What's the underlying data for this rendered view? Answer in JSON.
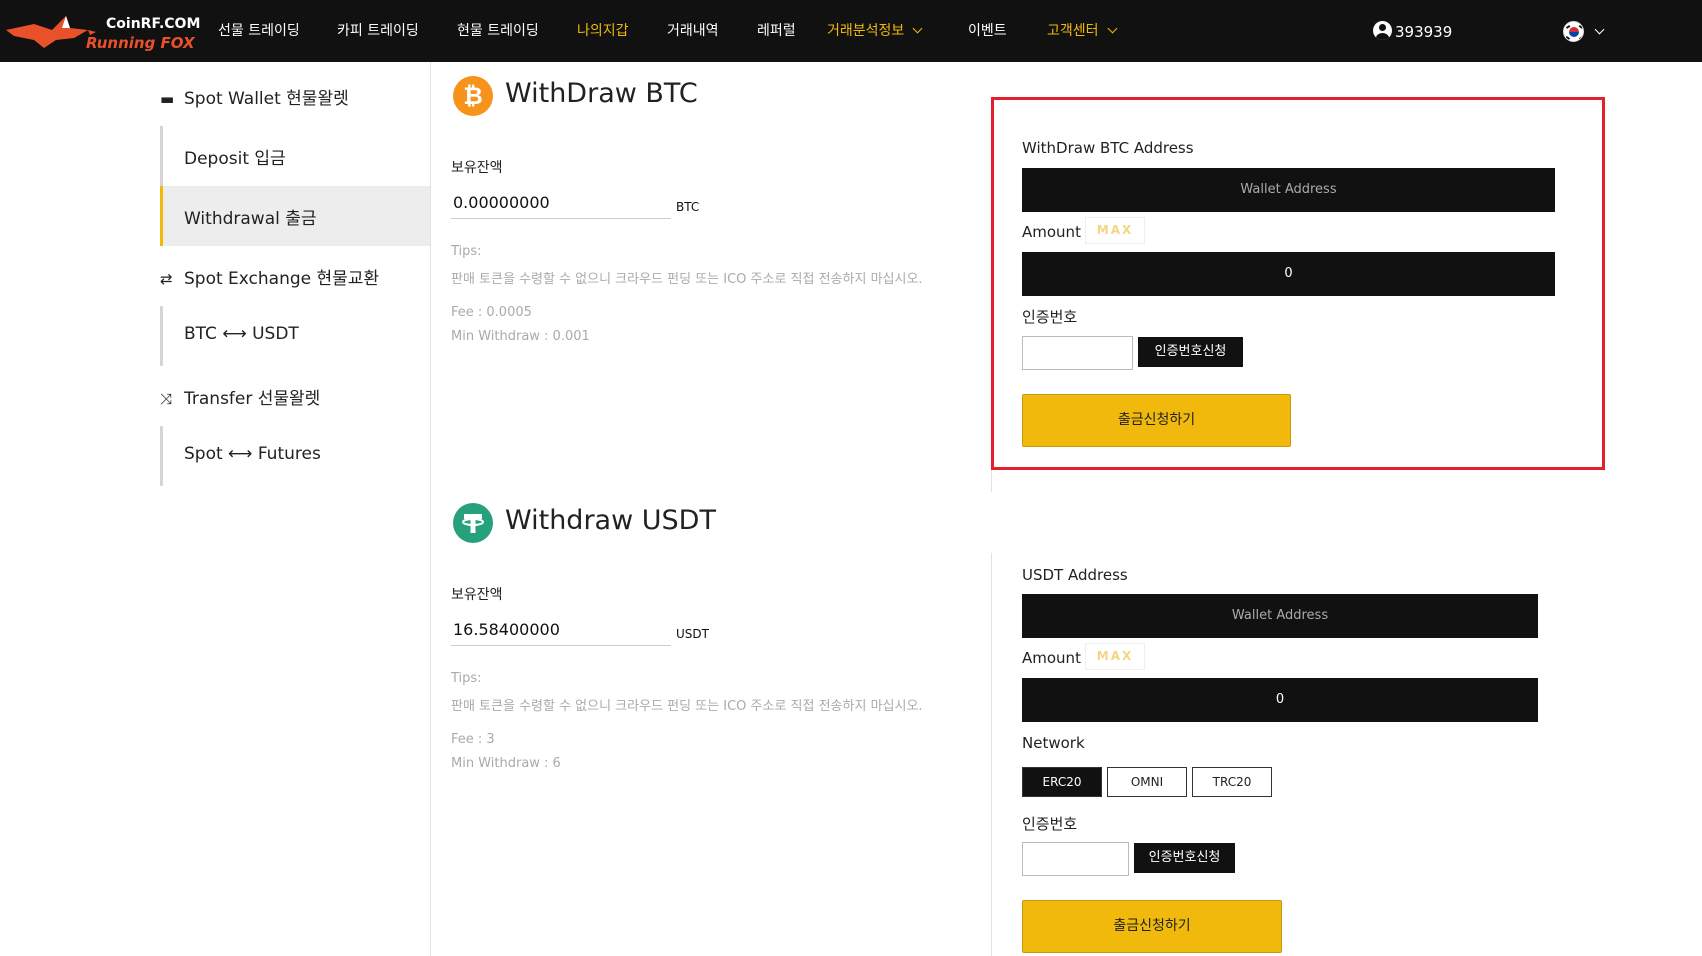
{
  "header": {
    "logo_top": "CoinRF.COM",
    "logo_bottom": "Running FOX",
    "nav": [
      {
        "label": "선물 트레이딩"
      },
      {
        "label": "카피 트레이딩"
      },
      {
        "label": "현물 트레이딩"
      },
      {
        "label": "나의지갑"
      },
      {
        "label": "거래내역"
      },
      {
        "label": "레퍼럴"
      },
      {
        "label": "거래분석정보"
      },
      {
        "label": "이벤트"
      },
      {
        "label": "고객센터"
      }
    ],
    "user_id": "393939",
    "active_color": "#f0b90b"
  },
  "sidebar": {
    "spot_wallet": "Spot Wallet 현물왈렛",
    "deposit": "Deposit 입금",
    "withdrawal": "Withdrawal 출금",
    "spot_exchange": "Spot Exchange 현물교환",
    "btc_usdt": "BTC ⟷ USDT",
    "transfer": "Transfer 선물왈렛",
    "spot_futures": "Spot ⟷ Futures"
  },
  "btc": {
    "title": "WithDraw BTC",
    "balance_label": "보유잔액",
    "balance": "0.00000000",
    "unit": "BTC",
    "tips_label": "Tips:",
    "tips_text": "판매 토큰을 수령할 수 없으니 크라우드 펀딩 또는 ICO 주소로 직접 전송하지 마십시오.",
    "fee": "Fee : 0.0005",
    "min_withdraw": "Min Withdraw : 0.001",
    "address_label": "WithDraw BTC Address",
    "address_placeholder": "Wallet Address",
    "amount_label": "Amount",
    "max_label": "MAX",
    "amount_value": "0",
    "code_label": "인증번호",
    "code_button": "인증번호신청",
    "submit": "출금신청하기"
  },
  "usdt": {
    "title": "Withdraw USDT",
    "balance_label": "보유잔액",
    "balance": "16.58400000",
    "unit": "USDT",
    "tips_label": "Tips:",
    "tips_text": "판매 토큰을 수령할 수 없으니 크라우드 펀딩 또는 ICO 주소로 직접 전송하지 마십시오.",
    "fee": "Fee : 3",
    "min_withdraw": "Min Withdraw : 6",
    "address_label": "USDT Address",
    "address_placeholder": "Wallet Address",
    "amount_label": "Amount",
    "max_label": "MAX",
    "amount_value": "0",
    "network_label": "Network",
    "networks": [
      {
        "label": "ERC20",
        "selected": true
      },
      {
        "label": "OMNI",
        "selected": false
      },
      {
        "label": "TRC20",
        "selected": false
      }
    ],
    "code_label": "인증번호",
    "code_button": "인증번호신청",
    "submit": "출금신청하기"
  }
}
